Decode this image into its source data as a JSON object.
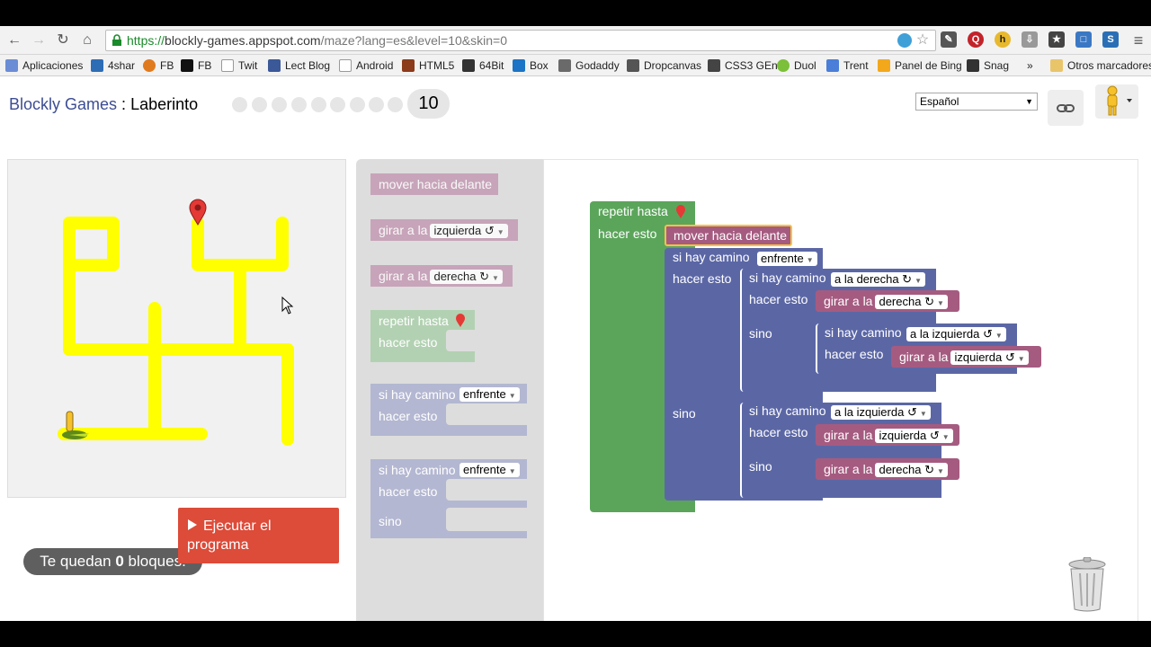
{
  "browser": {
    "url_scheme": "https://",
    "url_host": "blockly-games.appspot.com",
    "url_rest": "/maze?lang=es&level=10&skin=0",
    "bookmarks": [
      "Aplicaciones",
      "4shar",
      "FB",
      "FB",
      "Twit",
      "Lect Blog",
      "Android",
      "HTML5",
      "64Bit",
      "Box",
      "Godaddy",
      "Dropcanvas",
      "CSS3 GEn",
      "Duol",
      "Trent",
      "Panel de Bing",
      "Snag",
      "Otros marcadores"
    ],
    "overflow": "»"
  },
  "header": {
    "brand": "Blockly Games",
    "separator": " : ",
    "game": "Laberinto",
    "current_level": "10",
    "language": "Español"
  },
  "maze": {
    "blocks_left_prefix": "Te quedan ",
    "blocks_left_count": "0",
    "blocks_left_suffix": " bloques."
  },
  "run_button": {
    "label": "Ejecutar el programa"
  },
  "toolbox": {
    "move_forward": "mover hacia delante",
    "turn_label": "girar a la",
    "turn_left": "izquierda",
    "turn_right": "derecha",
    "repeat_until": "repetir hasta",
    "do_label": "hacer esto",
    "if_path": "si hay camino",
    "ahead": "enfrente",
    "else_label": "sino"
  },
  "program": {
    "repeat_until": "repetir hasta",
    "do_label": "hacer esto",
    "move_forward": "mover hacia delante",
    "if_path": "si hay camino",
    "ahead": "enfrente",
    "to_right": "a la derecha",
    "to_left": "a la izquierda",
    "turn_label": "girar a la",
    "right": "derecha",
    "left": "izquierda",
    "else_label": "sino"
  },
  "icons": {
    "back": "back-arrow-icon",
    "forward": "forward-arrow-icon",
    "reload": "reload-icon",
    "home": "home-icon",
    "star": "star-icon",
    "trash": "trash-icon"
  },
  "colors": {
    "loop": "#5ba55b",
    "logic": "#5b67a5",
    "action": "#a55b80",
    "path": "#ffff00",
    "run": "#dd4b39"
  }
}
